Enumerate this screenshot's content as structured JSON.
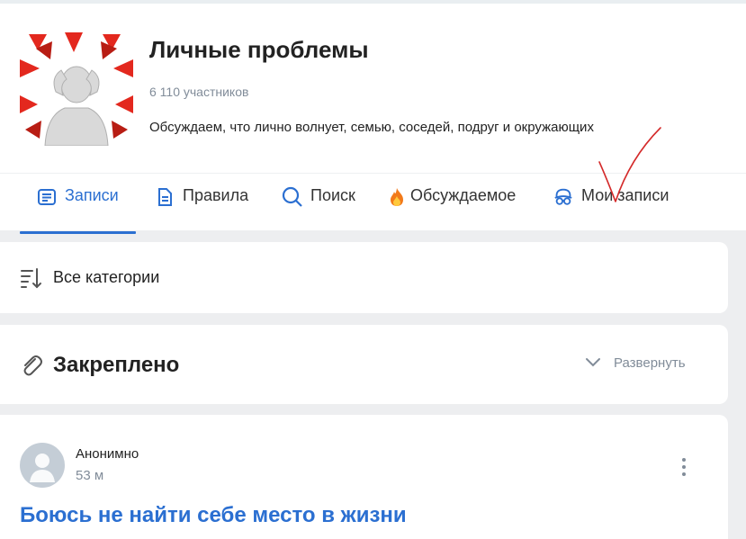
{
  "group": {
    "title": "Личные проблемы",
    "members": "6 110 участников",
    "description": "Обсуждаем, что лично волнует, семью, соседей, подруг и окружающих"
  },
  "tabs": [
    {
      "label": "Записи",
      "icon": "document-lines-icon",
      "active": true
    },
    {
      "label": "Правила",
      "icon": "document-icon",
      "active": false
    },
    {
      "label": "Поиск",
      "icon": "search-icon",
      "active": false
    },
    {
      "label": "Обсуждаемое",
      "icon": "fire-emoji-icon",
      "active": false
    },
    {
      "label": "Мои записи",
      "icon": "incognito-icon",
      "active": false
    }
  ],
  "categories": {
    "label": "Все категории",
    "icon": "sort-icon"
  },
  "pinned": {
    "label": "Закреплено",
    "icon": "paperclip-icon",
    "expand_label": "Развернуть"
  },
  "post": {
    "author": "Анонимно",
    "time": "53 м",
    "title": "Боюсь не найти себе место в жизни"
  },
  "colors": {
    "accent": "#2b6fd1",
    "muted": "#818c99",
    "background": "#edeef0",
    "annotation": "#d42a2a"
  }
}
